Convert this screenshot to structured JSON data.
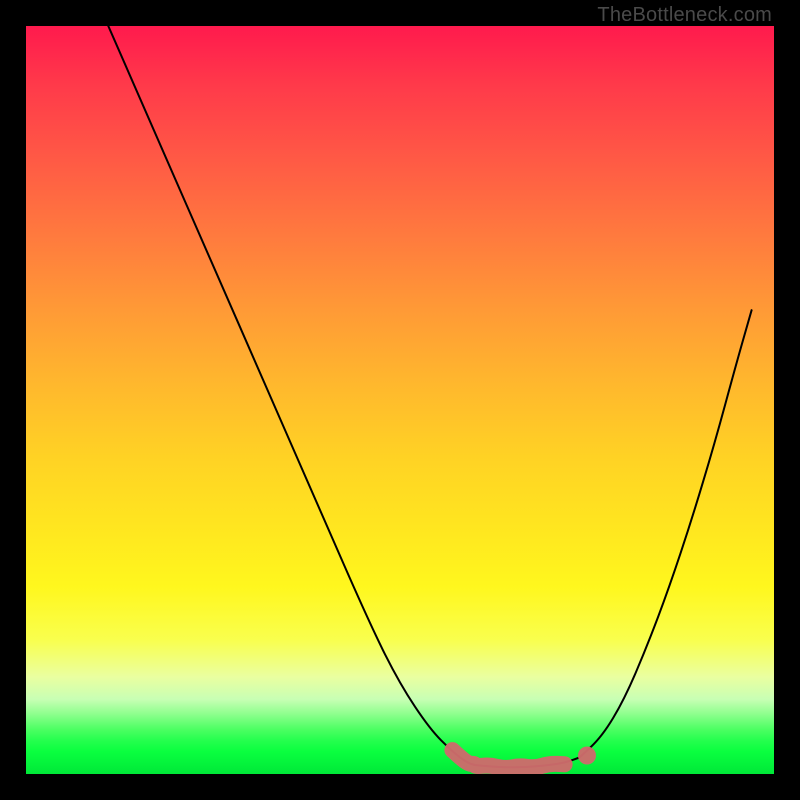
{
  "watermark": "TheBottleneck.com",
  "colors": {
    "frame": "#000000",
    "curve": "#000000",
    "worm": "#cc6b6b",
    "gradient_top": "#ff1a4d",
    "gradient_mid": "#ffe81f",
    "gradient_bottom": "#00e838"
  },
  "chart_data": {
    "type": "line",
    "title": "",
    "xlabel": "",
    "ylabel": "",
    "xlim": [
      0,
      100
    ],
    "ylim": [
      0,
      100
    ],
    "grid": false,
    "legend": false,
    "series": [
      {
        "name": "left-curve",
        "x": [
          11,
          18,
          25,
          32,
          39,
          46,
          50,
          54,
          57,
          59,
          60
        ],
        "y": [
          100,
          84,
          68,
          52,
          36,
          20,
          12,
          6,
          3,
          1.5,
          1.2
        ]
      },
      {
        "name": "valley-floor",
        "x": [
          60,
          62,
          64,
          66,
          68,
          70,
          72,
          74
        ],
        "y": [
          1.2,
          1.0,
          0.9,
          0.9,
          1.0,
          1.2,
          1.5,
          2.2
        ]
      },
      {
        "name": "right-curve",
        "x": [
          74,
          77,
          80,
          83,
          86,
          89,
          92,
          95,
          97
        ],
        "y": [
          2.2,
          5,
          10,
          17,
          25,
          34,
          44,
          55,
          62
        ]
      }
    ],
    "annotations": [
      {
        "name": "highlighted-valley-segment",
        "x_range": [
          55,
          75
        ],
        "description": "thick salmon-colored overlay marking the minimum region"
      }
    ]
  }
}
